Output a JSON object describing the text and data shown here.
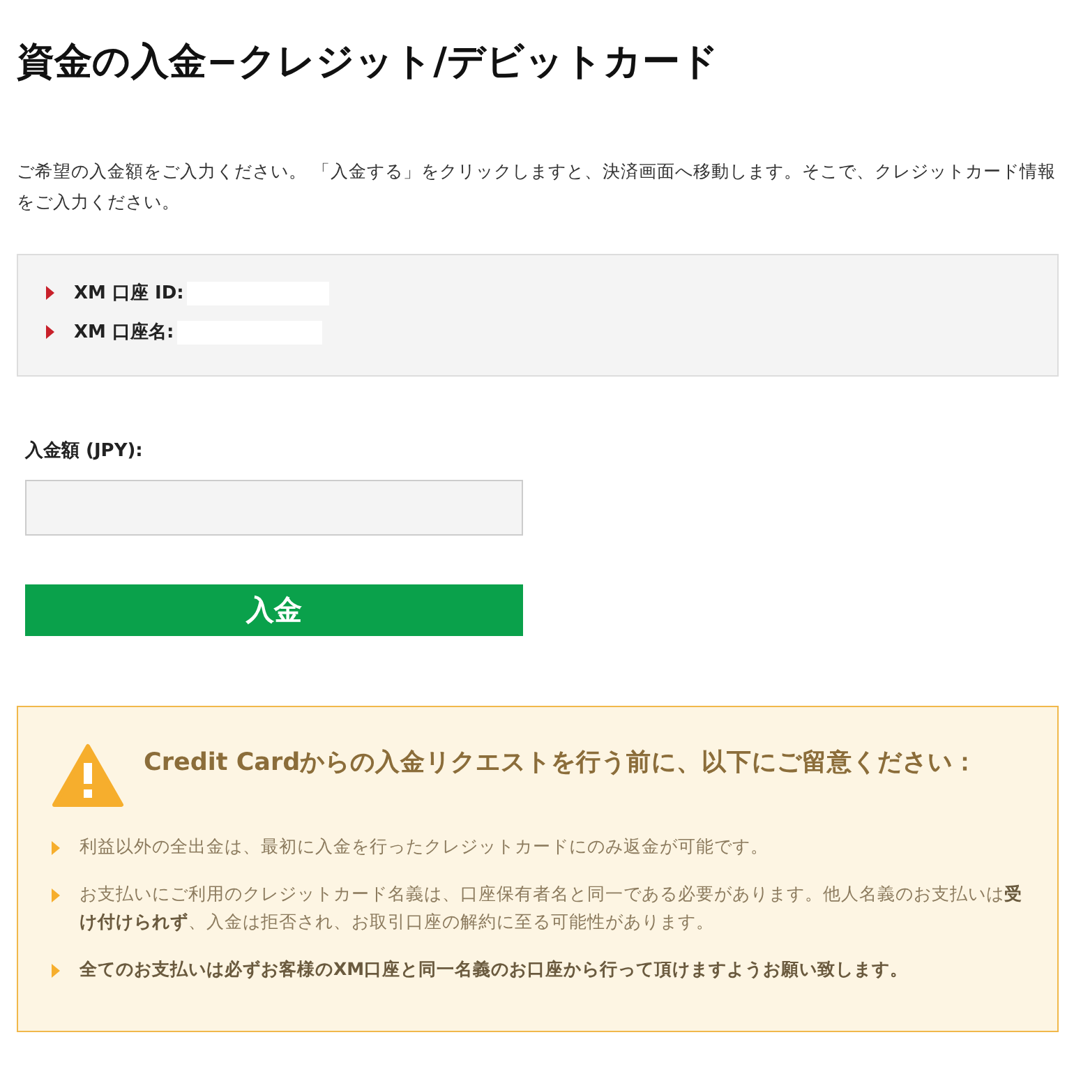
{
  "title": "資金の入金−クレジット/デビットカード",
  "intro": "ご希望の入金額をご入力ください。 「入金する」をクリックしますと、決済画面へ移動します。そこで、クレジットカード情報をご入力ください。",
  "account_info": [
    {
      "label": "XM 口座 ID:"
    },
    {
      "label": "XM 口座名:"
    }
  ],
  "amount_field": {
    "label": "入金額 (JPY):"
  },
  "submit_button": "入金",
  "notice": {
    "heading": "Credit Cardからの入金リクエストを行う前に、以下にご留意ください：",
    "items": [
      "利益以外の全出金は、最初に入金を行ったクレジットカードにのみ返金が可能です。",
      "お支払いにご利用のクレジットカード名義は、口座保有者名と同一である必要があります。他人名義のお支払いは**受け付けられず**、入金は拒否され、お取引口座の解約に至る可能性があります。",
      "**全てのお支払いは必ずお客様のXM口座と同一名義のお口座から行って頂けますようお願い致します。**"
    ]
  }
}
